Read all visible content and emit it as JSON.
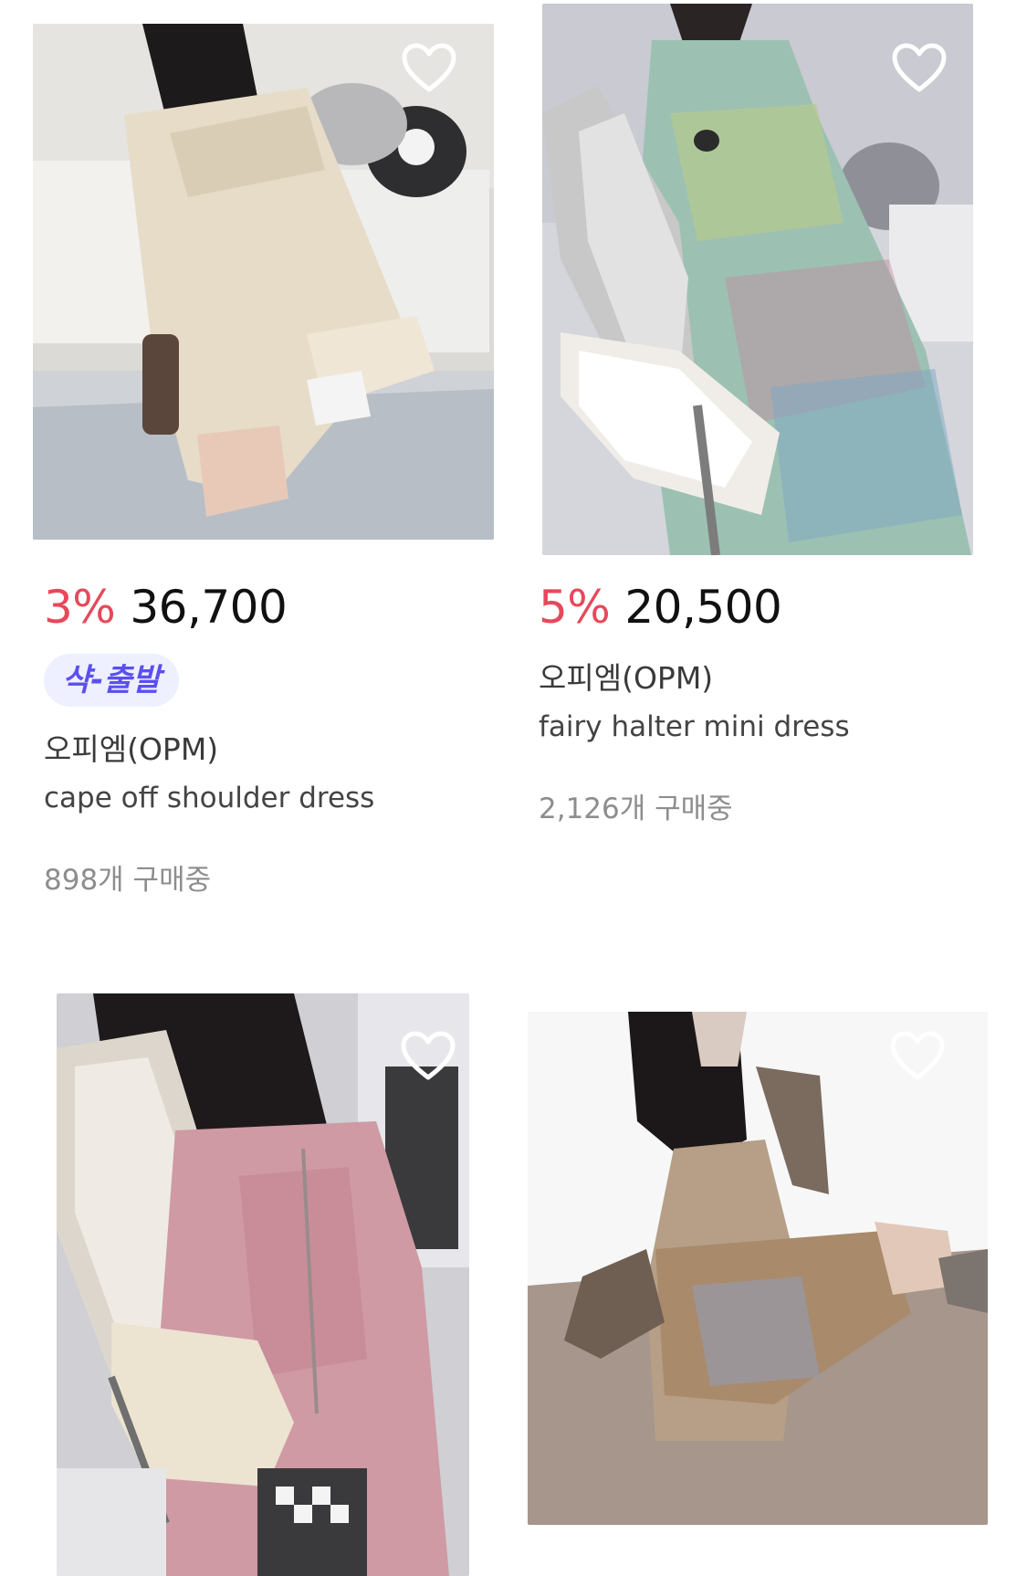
{
  "colors": {
    "discount": "#e6495a",
    "price": "#111111",
    "badge_bg": "#eef0ff",
    "badge_text": "#5b4ff0",
    "muted": "#8d8d8d"
  },
  "products": [
    {
      "image_icon": "product-photo-cream-cable-knit-off-shoulder-dress",
      "discount": "3%",
      "price": "36,700",
      "badge": "샥-출발",
      "brand": "오피엠(OPM)",
      "name": "cape off shoulder dress",
      "buyers": "898개 구매중"
    },
    {
      "image_icon": "product-photo-green-halter-dress-with-fur-scarf",
      "discount": "5%",
      "price": "20,500",
      "brand": "오피엠(OPM)",
      "name": "fairy halter mini dress",
      "buyers": "2,126개 구매중"
    },
    {
      "image_icon": "product-photo-pink-velour-jumpsuit-with-fur-hood"
    },
    {
      "image_icon": "product-photo-patchwork-print-dress-with-knit-sleeves"
    }
  ]
}
